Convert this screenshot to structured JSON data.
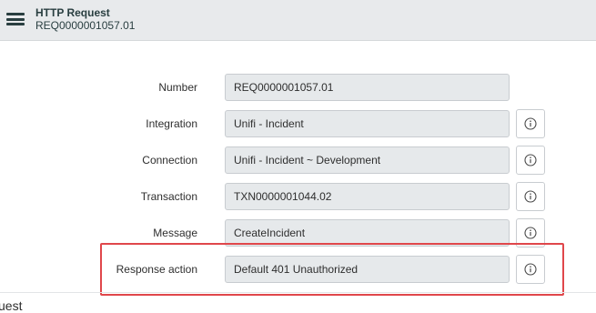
{
  "header": {
    "title": "HTTP Request",
    "subtitle": "REQ0000001057.01",
    "menu_icon": "hamburger-menu-icon"
  },
  "form": {
    "fields": [
      {
        "label": "Number",
        "value": "REQ0000001057.01",
        "has_info": false
      },
      {
        "label": "Integration",
        "value": "Unifi - Incident",
        "has_info": true
      },
      {
        "label": "Connection",
        "value": "Unifi - Incident ~ Development",
        "has_info": true
      },
      {
        "label": "Transaction",
        "value": "TXN0000001044.02",
        "has_info": true
      },
      {
        "label": "Message",
        "value": "CreateIncident",
        "has_info": true
      },
      {
        "label": "Response action",
        "value": "Default 401 Unauthorized",
        "has_info": true
      }
    ],
    "info_icon": "info-circle-icon"
  },
  "annotation": {
    "highlight_color": "#e0474b"
  },
  "section_below": {
    "partial_text": "uest"
  }
}
